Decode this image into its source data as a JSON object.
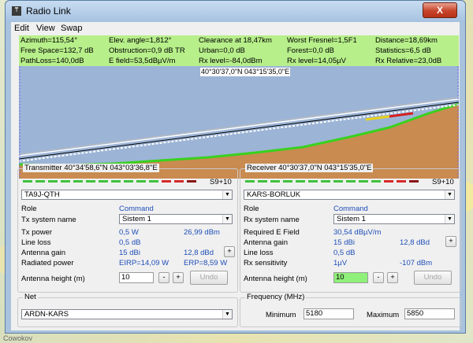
{
  "window": {
    "title": "Radio Link",
    "icon": "antenna-tower-icon",
    "close_label": "X"
  },
  "menu": [
    "Edit",
    "View",
    "Swap"
  ],
  "info": [
    [
      "Azimuth=115,54°",
      "Elev. angle=1,812°",
      "Clearance at 18,47km",
      "Worst Fresnel=1,5F1",
      "Distance=18,69km"
    ],
    [
      "Free Space=132,7 dB",
      "Obstruction=0,9 dB TR",
      "Urban=0,0 dB",
      "Forest=0,0 dB",
      "Statistics=6,5 dB"
    ],
    [
      "PathLoss=140,0dB",
      "E field=53,5dBµV/m",
      "Rx level=-84,0dBm",
      "Rx level=14,05µV",
      "Rx Relative=23,0dB"
    ]
  ],
  "profile": {
    "cursor_position": "40°30'37,0\"N 043°15'35,0\"E"
  },
  "transmitter": {
    "title": "Transmitter 40°34'58,6\"N 043°03'36,8\"E",
    "signal": "S9+10",
    "station": "TA9J-QTH",
    "role_label": "Role",
    "role_value": "Command",
    "system_label": "Tx system name",
    "system_value": "Sistem  1",
    "power_label": "Tx power",
    "power_w": "0,5 W",
    "power_dbm": "26,99 dBm",
    "lineloss_label": "Line loss",
    "lineloss_value": "0,5 dB",
    "gain_label": "Antenna gain",
    "gain_dbi": "15 dBi",
    "gain_dbd": "12,8 dBd",
    "radiated_label": "Radiated power",
    "eirp": "EIRP=14,09 W",
    "erp": "ERP=8,59 W",
    "height_label": "Antenna height (m)",
    "height_value": "10",
    "plus": "+",
    "minus": "-",
    "undo": "Undo"
  },
  "receiver": {
    "title": "Receiver 40°30'37,0\"N 043°15'35,0\"E",
    "signal": "S9+10",
    "station": "KARS-BORLUK",
    "role_label": "Role",
    "role_value": "Command",
    "system_label": "Rx system name",
    "system_value": "Sistem  1",
    "efield_label": "Required E Field",
    "efield_value": "30,54 dBµV/m",
    "gain_label": "Antenna gain",
    "gain_dbi": "15 dBi",
    "gain_dbd": "12,8 dBd",
    "lineloss_label": "Line loss",
    "lineloss_value": "0,5 dB",
    "sens_label": "Rx sensitivity",
    "sens_uv": "1µV",
    "sens_dbm": "-107 dBm",
    "height_label": "Antenna height (m)",
    "height_value": "10",
    "plus": "+",
    "minus": "-",
    "undo": "Undo"
  },
  "net": {
    "title": "Net",
    "value": "ARDN-KARS"
  },
  "frequency": {
    "title": "Frequency (MHz)",
    "min_label": "Minimum",
    "min_value": "5180",
    "max_label": "Maximum",
    "max_value": "5850"
  },
  "footer": {
    "text": "Cowokov"
  },
  "colors": {
    "info_bg": "#b7ef8a",
    "terrain": "#c98b50",
    "sky": "#9cb4d6",
    "highlight_input": "#8ff07a"
  }
}
